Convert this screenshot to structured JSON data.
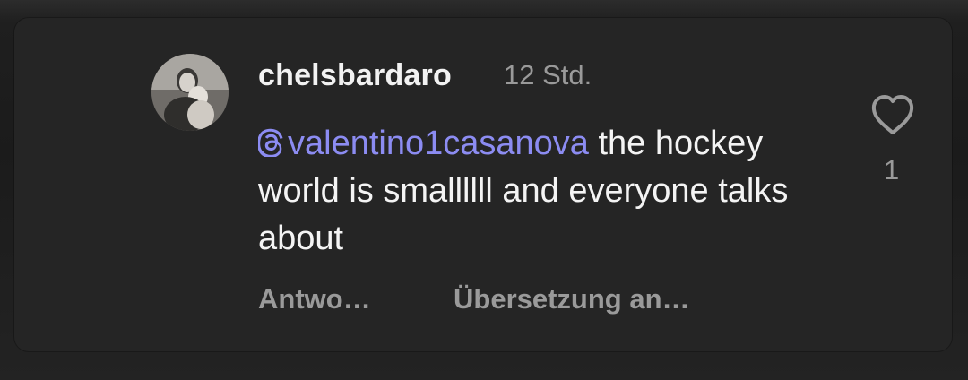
{
  "comment": {
    "username": "chelsbardaro",
    "timestamp": "12 Std.",
    "mention": "valentino1casanova",
    "text": " the hockey world is smallllll and everyone talks about",
    "like_count": "1"
  },
  "actions": {
    "reply_label": "Antwo…",
    "translate_label": "Übersetzung an…"
  },
  "icons": {
    "like": "heart-icon",
    "mention": "threads-at-icon"
  },
  "colors": {
    "background": "#252525",
    "mention": "#8c8cf2",
    "muted": "#9a9a9a",
    "text": "#f4f4f4"
  }
}
